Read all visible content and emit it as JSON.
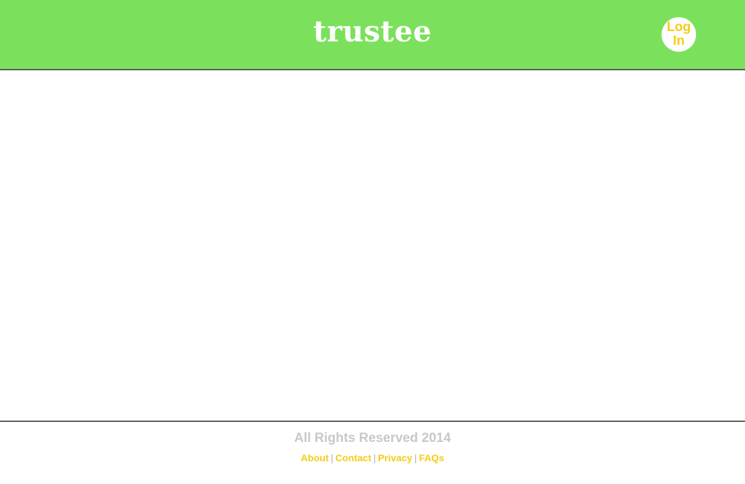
{
  "header": {
    "brand": "trustee",
    "login_label": "Log In"
  },
  "footer": {
    "copyright": "All Rights Reserved 2014",
    "links": [
      {
        "label": "About"
      },
      {
        "label": "Contact"
      },
      {
        "label": "Privacy"
      },
      {
        "label": "FAQs"
      }
    ],
    "separator": "|"
  },
  "colors": {
    "header_bg": "#7be15c",
    "accent": "#f5cc14",
    "muted_text": "#c8c8c8",
    "divider": "#5a5a5a"
  }
}
